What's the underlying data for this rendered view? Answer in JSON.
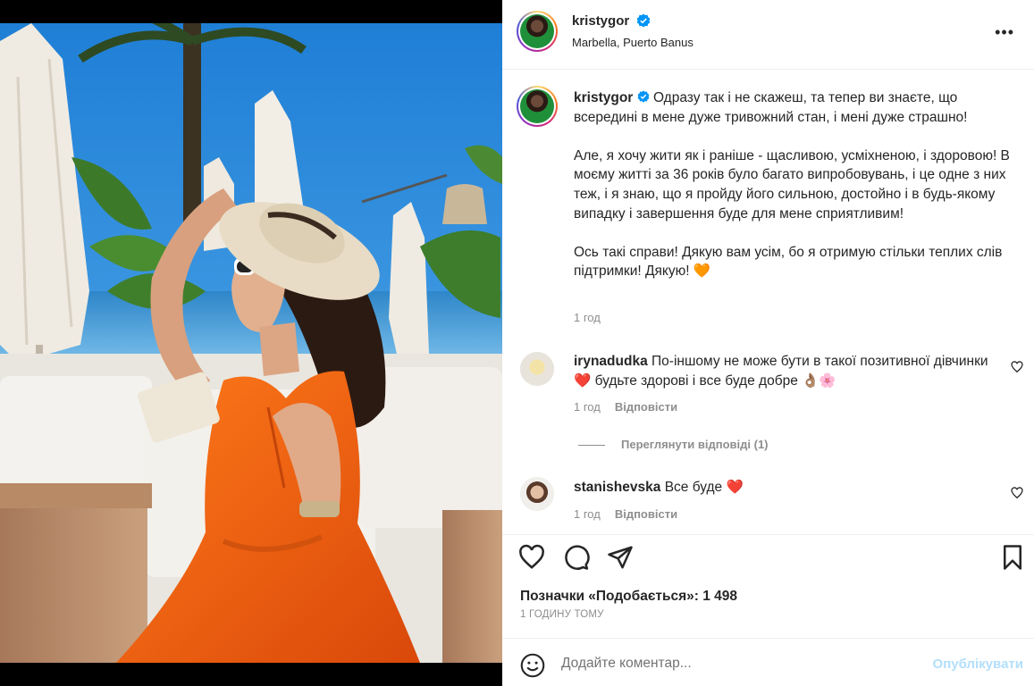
{
  "post": {
    "username": "kristygor",
    "location": "Marbella, Puerto Banus",
    "caption_paragraphs": [
      "Одразу так і не скажеш, та тепер ви знаєте, що всередині в мене дуже тривожний стан, і мені дуже страшно!",
      "Але, я хочу жити як і раніше - щасливою, усміхненою, і здоровою! В моєму житті за 36 років було багато випробовувань, і це одне з них теж, і я знаю, що я пройду його сильною, достойно і в будь-якому випадку і завершення буде для мене сприятливим!",
      "Ось такі справи! Дякую вам усім, бо я отримую стільки теплих слів підтримки! Дякую! 🧡"
    ],
    "caption_time": "1 год"
  },
  "comments": [
    {
      "username": "irynadudka",
      "text": "По-іншому не може бути в такої позитивної дівчинки ❤️ будьте здорові і все буде добре 👌🏽🌸",
      "time": "1 год",
      "reply_label": "Відповісти"
    },
    {
      "username": "stanishevska",
      "text": "Все буде ❤️",
      "time": "1 год",
      "reply_label": "Відповісти"
    }
  ],
  "view_replies_label": "Переглянути відповіді (1)",
  "likes_label": "Позначки «Подобається»: 1 498",
  "posted_label": "1 ГОДИНУ ТОМУ",
  "comment_box": {
    "placeholder": "Додайте коментар...",
    "publish_label": "Опублікувати"
  },
  "colors": {
    "verified": "#0095f6",
    "publish_disabled": "#b2dffc",
    "secondary_text": "#8e8e8e",
    "dress": "#f2620f",
    "sky": "#2f8fdc"
  }
}
